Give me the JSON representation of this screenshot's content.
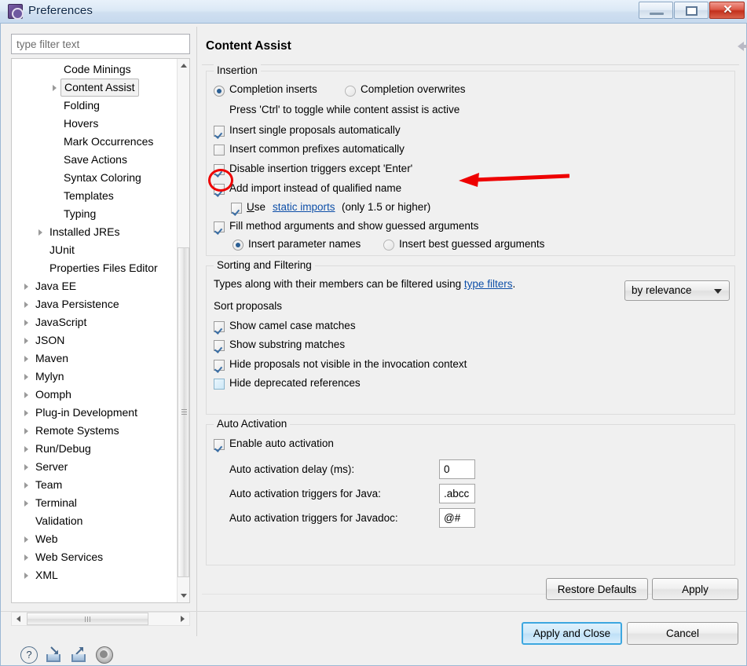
{
  "window": {
    "title": "Preferences",
    "icon": "preferences-gear-icon",
    "minimize_label": "",
    "maximize_label": "",
    "close_label": "✕"
  },
  "sidebar": {
    "filter": {
      "placeholder": "type filter text",
      "value": ""
    },
    "items": [
      {
        "label": "Code Minings",
        "indent": 2,
        "arrow": false,
        "selected": false
      },
      {
        "label": "Content Assist",
        "indent": 2,
        "arrow": true,
        "selected": true
      },
      {
        "label": "Folding",
        "indent": 2,
        "arrow": false,
        "selected": false
      },
      {
        "label": "Hovers",
        "indent": 2,
        "arrow": false,
        "selected": false
      },
      {
        "label": "Mark Occurrences",
        "indent": 2,
        "arrow": false,
        "selected": false
      },
      {
        "label": "Save Actions",
        "indent": 2,
        "arrow": false,
        "selected": false
      },
      {
        "label": "Syntax Coloring",
        "indent": 2,
        "arrow": false,
        "selected": false
      },
      {
        "label": "Templates",
        "indent": 2,
        "arrow": false,
        "selected": false
      },
      {
        "label": "Typing",
        "indent": 2,
        "arrow": false,
        "selected": false
      },
      {
        "label": "Installed JREs",
        "indent": 1,
        "arrow": true,
        "selected": false
      },
      {
        "label": "JUnit",
        "indent": 1,
        "arrow": false,
        "selected": false
      },
      {
        "label": "Properties Files Editor",
        "indent": 1,
        "arrow": false,
        "selected": false
      },
      {
        "label": "Java EE",
        "indent": 0,
        "arrow": true,
        "selected": false
      },
      {
        "label": "Java Persistence",
        "indent": 0,
        "arrow": true,
        "selected": false
      },
      {
        "label": "JavaScript",
        "indent": 0,
        "arrow": true,
        "selected": false
      },
      {
        "label": "JSON",
        "indent": 0,
        "arrow": true,
        "selected": false
      },
      {
        "label": "Maven",
        "indent": 0,
        "arrow": true,
        "selected": false
      },
      {
        "label": "Mylyn",
        "indent": 0,
        "arrow": true,
        "selected": false
      },
      {
        "label": "Oomph",
        "indent": 0,
        "arrow": true,
        "selected": false
      },
      {
        "label": "Plug-in Development",
        "indent": 0,
        "arrow": true,
        "selected": false
      },
      {
        "label": "Remote Systems",
        "indent": 0,
        "arrow": true,
        "selected": false
      },
      {
        "label": "Run/Debug",
        "indent": 0,
        "arrow": true,
        "selected": false
      },
      {
        "label": "Server",
        "indent": 0,
        "arrow": true,
        "selected": false
      },
      {
        "label": "Team",
        "indent": 0,
        "arrow": true,
        "selected": false
      },
      {
        "label": "Terminal",
        "indent": 0,
        "arrow": true,
        "selected": false
      },
      {
        "label": "Validation",
        "indent": 0,
        "arrow": false,
        "selected": false
      },
      {
        "label": "Web",
        "indent": 0,
        "arrow": true,
        "selected": false
      },
      {
        "label": "Web Services",
        "indent": 0,
        "arrow": true,
        "selected": false
      },
      {
        "label": "XML",
        "indent": 0,
        "arrow": true,
        "selected": false
      }
    ]
  },
  "page": {
    "title": "Content Assist",
    "nav": {
      "back_icon": "arrow-left-icon",
      "back_menu_icon": "chevron-down-icon",
      "forward_icon": "arrow-right-icon",
      "forward_menu_icon": "chevron-down-icon",
      "view_menu_icon": "chevron-down-icon"
    },
    "insertion": {
      "title": "Insertion",
      "mode_inserts": "Completion inserts",
      "mode_overwrites": "Completion overwrites",
      "mode_selected": "Completion inserts",
      "hint": "Press 'Ctrl' to toggle while content assist is active",
      "checkboxes": [
        {
          "label": "Insert single proposals automatically",
          "checked": true
        },
        {
          "label": "Insert common prefixes automatically",
          "checked": false
        },
        {
          "label": "Disable insertion triggers except 'Enter'",
          "checked": true
        },
        {
          "label": "Add import instead of qualified name",
          "checked": true
        }
      ],
      "static_imports": {
        "checked": true,
        "prefix_mnemonic": "U",
        "prefix_rest": "se",
        "link": "static imports",
        "suffix": "(only 1.5 or higher)"
      },
      "fill_method_args": {
        "label": "Fill method arguments and show guessed arguments",
        "checked": true
      },
      "arg_mode_names": "Insert parameter names",
      "arg_mode_guessed": "Insert best guessed arguments",
      "arg_mode_selected": "Insert parameter names"
    },
    "sorting": {
      "title": "Sorting and Filtering",
      "description_prefix": "Types along with their members can be filtered using ",
      "description_link": "type filters",
      "description_suffix": ".",
      "sort_label": "Sort proposals",
      "sort_value": "by relevance",
      "sort_caret_icon": "chevron-down-icon",
      "checkboxes": [
        {
          "label": "Show camel case matches",
          "checked": true,
          "tinted": false
        },
        {
          "label": "Show substring matches",
          "checked": true,
          "tinted": false
        },
        {
          "label": "Hide proposals not visible in the invocation context",
          "checked": true,
          "tinted": false
        },
        {
          "label": "Hide deprecated references",
          "checked": false,
          "tinted": true
        }
      ]
    },
    "auto_activation": {
      "title": "Auto Activation",
      "enable": {
        "label": "Enable auto activation",
        "checked": true
      },
      "fields": [
        {
          "label": "Auto activation delay (ms):",
          "value": "0"
        },
        {
          "label": "Auto activation triggers for Java:",
          "value": ".abcc"
        },
        {
          "label": "Auto activation triggers for Javadoc:",
          "value": "@#"
        }
      ]
    }
  },
  "buttons": {
    "restore_defaults": "Restore Defaults",
    "apply": "Apply",
    "apply_and_close": "Apply and Close",
    "cancel": "Cancel"
  },
  "footer_icons": [
    {
      "name": "help-icon",
      "glyph": "?"
    },
    {
      "name": "import-icon",
      "glyph": "↘"
    },
    {
      "name": "export-icon",
      "glyph": "↗"
    },
    {
      "name": "disc-icon",
      "glyph": "●"
    }
  ],
  "annotations": {
    "ellipse_target": "Disable insertion triggers except 'Enter' checkbox",
    "arrow_target": "Disable insertion triggers except 'Enter'",
    "color": "#ee0000"
  },
  "scrollbars": {
    "tree_vertical": {
      "up_icon": "triangle-up-icon",
      "down_icon": "triangle-down-icon"
    },
    "tree_horizontal": {
      "left_icon": "triangle-left-icon",
      "right_icon": "triangle-right-icon"
    }
  }
}
